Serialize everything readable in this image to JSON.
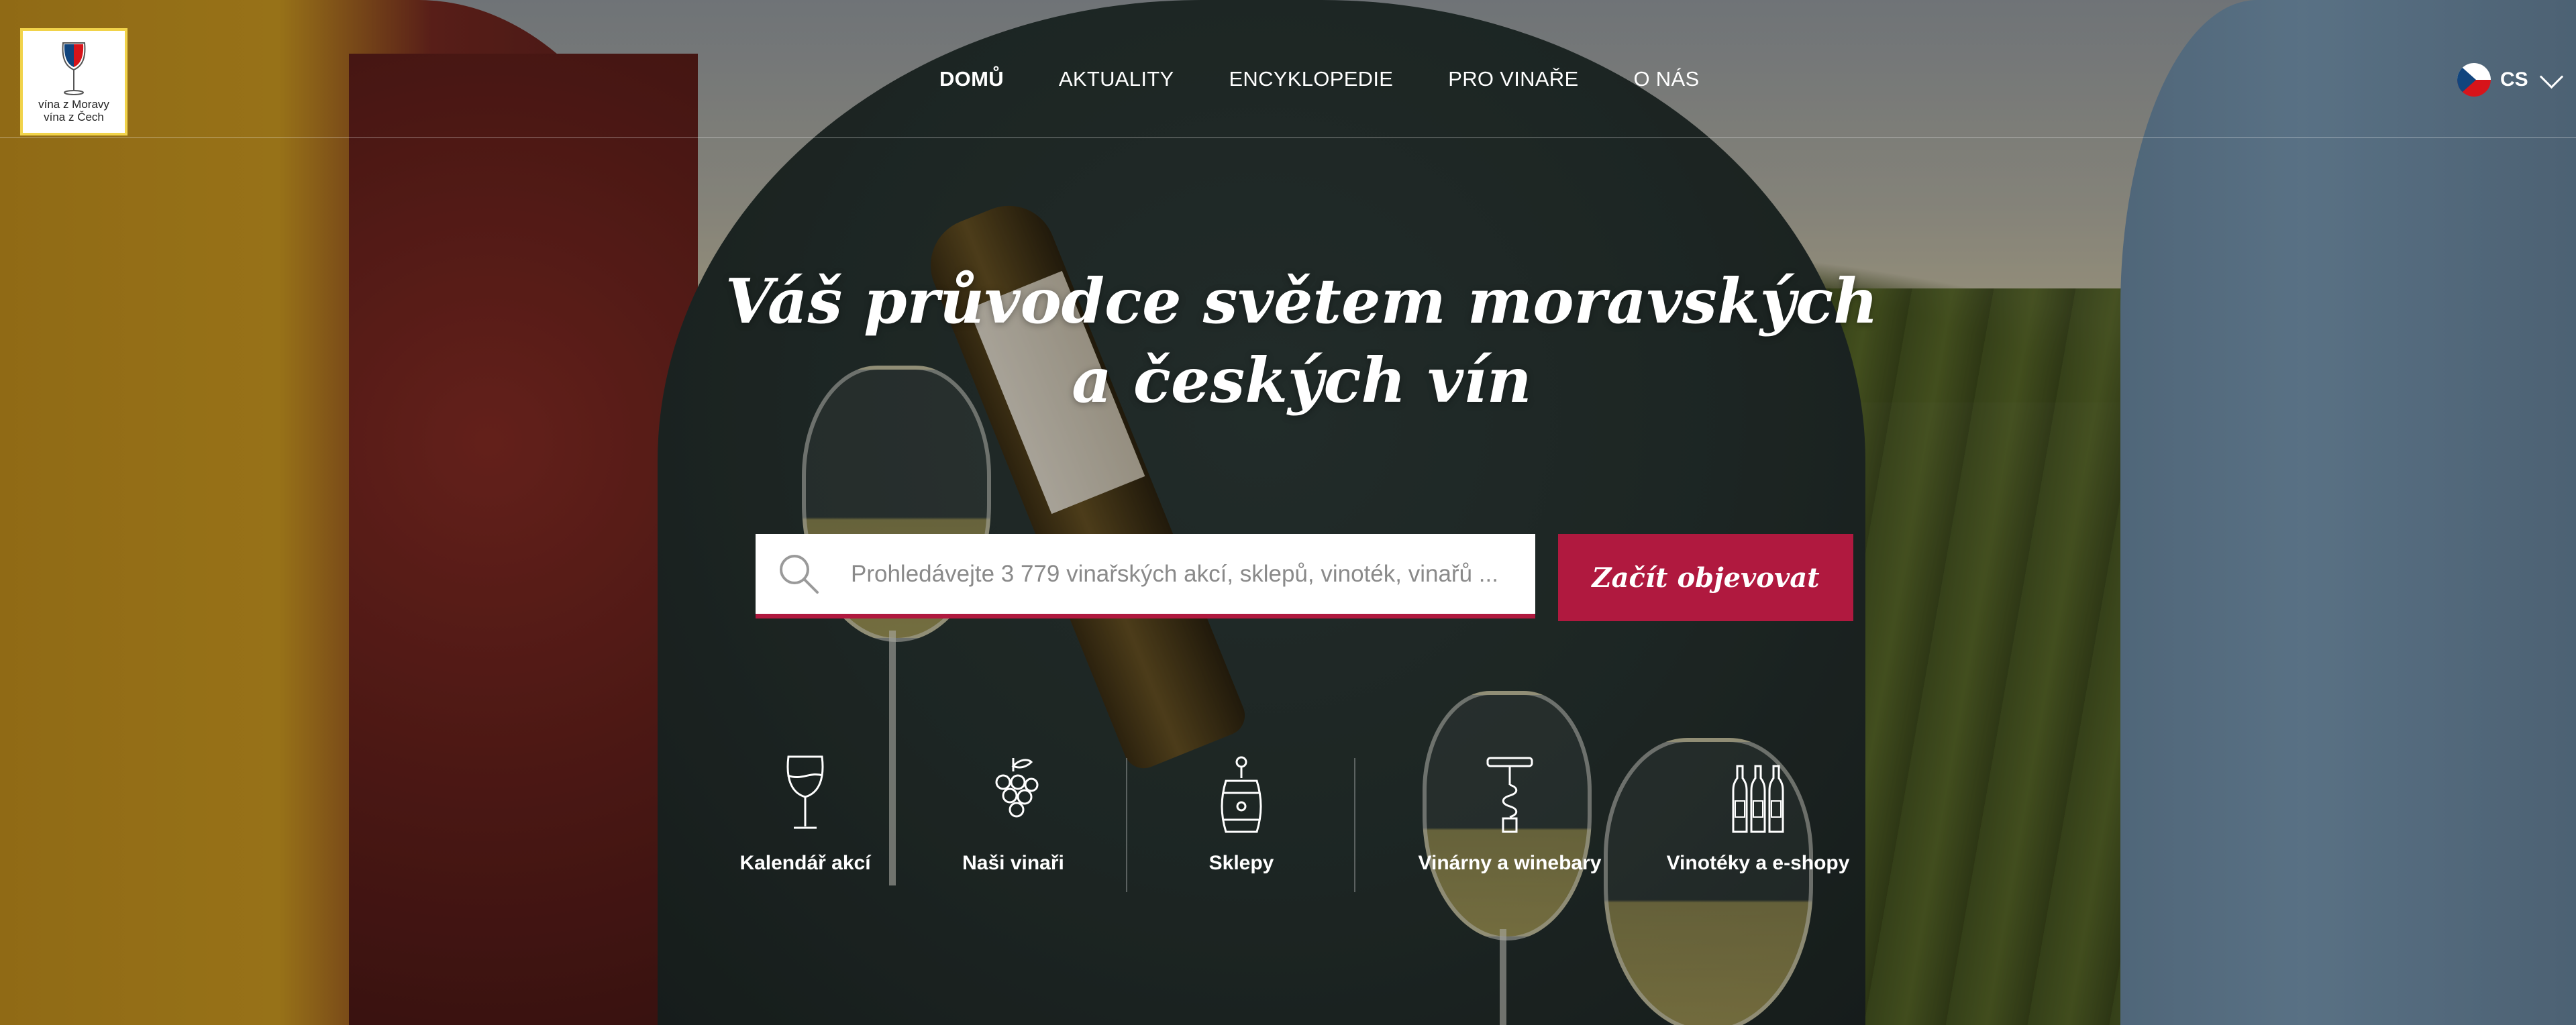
{
  "logo": {
    "line1": "vína z Moravy",
    "line2": "vína z Čech"
  },
  "nav": {
    "items": [
      {
        "label": "DOMŮ",
        "active": true
      },
      {
        "label": "AKTUALITY"
      },
      {
        "label": "ENCYKLOPEDIE"
      },
      {
        "label": "PRO VINAŘE"
      },
      {
        "label": "O NÁS"
      }
    ]
  },
  "language": {
    "code": "CS"
  },
  "hero": {
    "title_line1": "Váš průvodce světem moravských",
    "title_line2": "a českých vín"
  },
  "search": {
    "placeholder": "Prohledávejte 3 779 vinařských akcí, sklepů, vinoték, vinařů ...",
    "button_label": "Začít objevovat"
  },
  "categories": [
    {
      "label": "Kalendář akcí",
      "icon": "wine-glass-icon"
    },
    {
      "label": "Naši vinaři",
      "icon": "grapes-icon"
    },
    {
      "label": "Sklepy",
      "icon": "barrel-icon"
    },
    {
      "label": "Vinárny a winebary",
      "icon": "corkscrew-icon"
    },
    {
      "label": "Vinotéky a e-shopy",
      "icon": "bottles-icon"
    }
  ],
  "colors": {
    "accent": "#b0193f",
    "logo_border": "#f1d34a"
  }
}
